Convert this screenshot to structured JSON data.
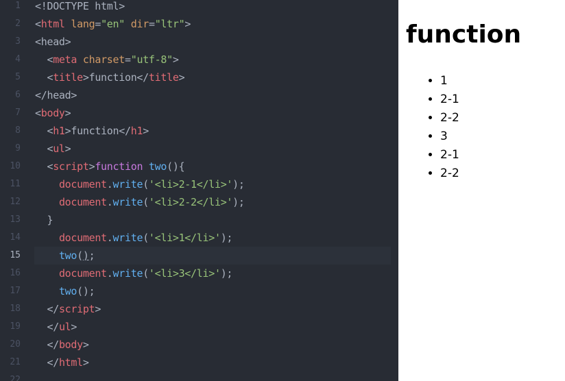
{
  "editor": {
    "active_line": 15,
    "lines": [
      {
        "n": "1",
        "tokens": [
          {
            "c": "txt",
            "t": "<!DOCTYPE html>"
          }
        ]
      },
      {
        "n": "2",
        "tokens": [
          {
            "c": "txt",
            "t": "<"
          },
          {
            "c": "tag",
            "t": "html"
          },
          {
            "c": "txt",
            "t": " "
          },
          {
            "c": "attr",
            "t": "lang"
          },
          {
            "c": "txt",
            "t": "="
          },
          {
            "c": "str",
            "t": "\"en\""
          },
          {
            "c": "txt",
            "t": " "
          },
          {
            "c": "attr",
            "t": "dir"
          },
          {
            "c": "txt",
            "t": "="
          },
          {
            "c": "str",
            "t": "\"ltr\""
          },
          {
            "c": "txt",
            "t": ">"
          }
        ]
      },
      {
        "n": "3",
        "tokens": [
          {
            "c": "txt",
            "t": "<head>"
          }
        ]
      },
      {
        "n": "4",
        "tokens": [
          {
            "c": "txt",
            "t": "  <"
          },
          {
            "c": "tag",
            "t": "meta"
          },
          {
            "c": "txt",
            "t": " "
          },
          {
            "c": "attr",
            "t": "charset"
          },
          {
            "c": "txt",
            "t": "="
          },
          {
            "c": "str",
            "t": "\"utf-8\""
          },
          {
            "c": "txt",
            "t": ">"
          }
        ]
      },
      {
        "n": "5",
        "tokens": [
          {
            "c": "txt",
            "t": "  <"
          },
          {
            "c": "tag",
            "t": "title"
          },
          {
            "c": "txt",
            "t": ">function</"
          },
          {
            "c": "tag",
            "t": "title"
          },
          {
            "c": "txt",
            "t": ">"
          }
        ]
      },
      {
        "n": "6",
        "tokens": [
          {
            "c": "txt",
            "t": "</head>"
          }
        ]
      },
      {
        "n": "7",
        "tokens": [
          {
            "c": "txt",
            "t": "<"
          },
          {
            "c": "tag",
            "t": "body"
          },
          {
            "c": "txt",
            "t": ">"
          }
        ]
      },
      {
        "n": "8",
        "tokens": [
          {
            "c": "txt",
            "t": "  <"
          },
          {
            "c": "tag",
            "t": "h1"
          },
          {
            "c": "txt",
            "t": ">function</"
          },
          {
            "c": "tag",
            "t": "h1"
          },
          {
            "c": "txt",
            "t": ">"
          }
        ]
      },
      {
        "n": "9",
        "tokens": [
          {
            "c": "txt",
            "t": "  <"
          },
          {
            "c": "tag",
            "t": "ul"
          },
          {
            "c": "txt",
            "t": ">"
          }
        ]
      },
      {
        "n": "10",
        "tokens": [
          {
            "c": "txt",
            "t": "  <"
          },
          {
            "c": "tag",
            "t": "script"
          },
          {
            "c": "txt",
            "t": ">"
          },
          {
            "c": "kw",
            "t": "function"
          },
          {
            "c": "txt",
            "t": " "
          },
          {
            "c": "fn",
            "t": "two"
          },
          {
            "c": "txt",
            "t": "(){"
          }
        ]
      },
      {
        "n": "11",
        "tokens": [
          {
            "c": "txt",
            "t": "    "
          },
          {
            "c": "tag",
            "t": "document"
          },
          {
            "c": "txt",
            "t": "."
          },
          {
            "c": "fn",
            "t": "write"
          },
          {
            "c": "txt",
            "t": "("
          },
          {
            "c": "str",
            "t": "'<li>2-1</li>'"
          },
          {
            "c": "txt",
            "t": ");"
          }
        ]
      },
      {
        "n": "12",
        "tokens": [
          {
            "c": "txt",
            "t": "    "
          },
          {
            "c": "tag",
            "t": "document"
          },
          {
            "c": "txt",
            "t": "."
          },
          {
            "c": "fn",
            "t": "write"
          },
          {
            "c": "txt",
            "t": "("
          },
          {
            "c": "str",
            "t": "'<li>2-2</li>'"
          },
          {
            "c": "txt",
            "t": ");"
          }
        ]
      },
      {
        "n": "13",
        "tokens": [
          {
            "c": "txt",
            "t": "  }"
          }
        ]
      },
      {
        "n": "14",
        "tokens": [
          {
            "c": "txt",
            "t": "    "
          },
          {
            "c": "tag",
            "t": "document"
          },
          {
            "c": "txt",
            "t": "."
          },
          {
            "c": "fn",
            "t": "write"
          },
          {
            "c": "txt",
            "t": "("
          },
          {
            "c": "str",
            "t": "'<li>1</li>'"
          },
          {
            "c": "txt",
            "t": ");"
          }
        ]
      },
      {
        "n": "15",
        "tokens": [
          {
            "c": "txt",
            "t": "    "
          },
          {
            "c": "fn",
            "t": "two"
          },
          {
            "c": "txt",
            "t": "("
          },
          {
            "c": "txt",
            "t": ")",
            "u": true
          },
          {
            "c": "txt",
            "t": ";"
          }
        ]
      },
      {
        "n": "16",
        "tokens": [
          {
            "c": "txt",
            "t": "    "
          },
          {
            "c": "tag",
            "t": "document"
          },
          {
            "c": "txt",
            "t": "."
          },
          {
            "c": "fn",
            "t": "write"
          },
          {
            "c": "txt",
            "t": "("
          },
          {
            "c": "str",
            "t": "'<li>3</li>'"
          },
          {
            "c": "txt",
            "t": ");"
          }
        ]
      },
      {
        "n": "17",
        "tokens": [
          {
            "c": "txt",
            "t": "    "
          },
          {
            "c": "fn",
            "t": "two"
          },
          {
            "c": "txt",
            "t": "();"
          }
        ]
      },
      {
        "n": "18",
        "tokens": [
          {
            "c": "txt",
            "t": "  </"
          },
          {
            "c": "tag",
            "t": "script"
          },
          {
            "c": "txt",
            "t": ">"
          }
        ]
      },
      {
        "n": "19",
        "tokens": [
          {
            "c": "txt",
            "t": "  </"
          },
          {
            "c": "tag",
            "t": "ul"
          },
          {
            "c": "txt",
            "t": ">"
          }
        ]
      },
      {
        "n": "20",
        "tokens": [
          {
            "c": "txt",
            "t": "  </"
          },
          {
            "c": "tag",
            "t": "body"
          },
          {
            "c": "txt",
            "t": ">"
          }
        ]
      },
      {
        "n": "21",
        "tokens": [
          {
            "c": "txt",
            "t": "  </"
          },
          {
            "c": "tag",
            "t": "html"
          },
          {
            "c": "txt",
            "t": ">"
          }
        ]
      },
      {
        "n": "22",
        "tokens": []
      }
    ]
  },
  "preview": {
    "heading": "function",
    "items": [
      "1",
      "2-1",
      "2-2",
      "3",
      "2-1",
      "2-2"
    ]
  },
  "colors": {
    "editor_bg": "#282c34",
    "tag": "#e06c75",
    "attribute": "#d19a66",
    "string": "#98c379",
    "keyword": "#c678dd",
    "function": "#61afef",
    "text": "#abb2bf"
  }
}
